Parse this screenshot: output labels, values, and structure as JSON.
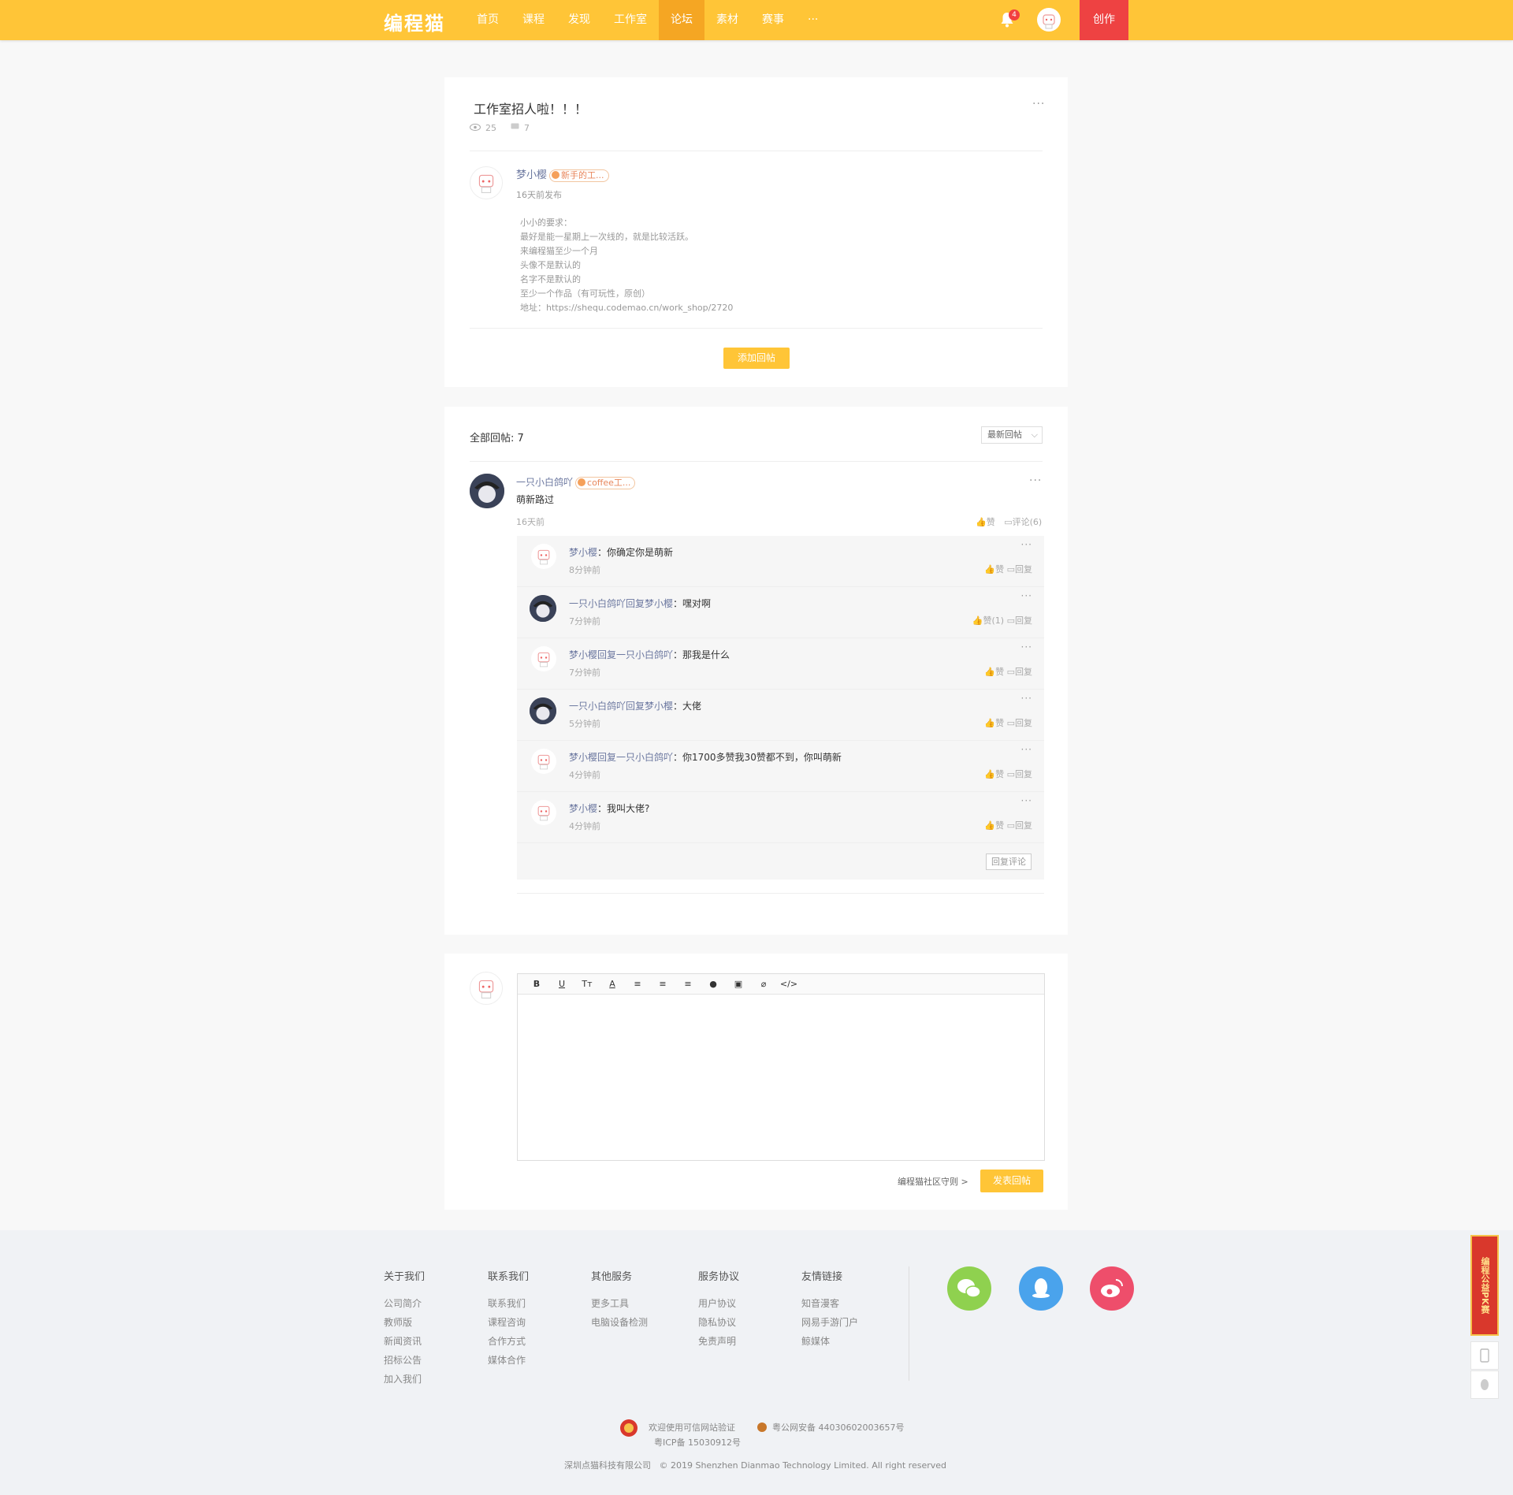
{
  "header": {
    "logo": "编程猫",
    "nav": [
      "首页",
      "课程",
      "发现",
      "工作室",
      "论坛",
      "素材",
      "赛事",
      "···"
    ],
    "active_nav": 4,
    "notif_count": "4",
    "create_label": "创作"
  },
  "post": {
    "title": "工作室招人啦！！！",
    "views": "25",
    "replies": "7",
    "author": "梦小樱",
    "author_badge": "新手的工...",
    "time": "16天前发布",
    "body": [
      "小小的要求：",
      "最好是能一星期上一次线的，就是比较活跃。",
      "来编程猫至少一个月",
      "头像不是默认的",
      "名字不是默认的",
      "至少一个作品（有可玩性，原创）",
      "地址：https://shequ.codemao.cn/work_shop/2720"
    ],
    "add_reply": "添加回帖",
    "more": "···"
  },
  "replies": {
    "title": "全部回帖: 7",
    "sort": "最新回帖",
    "main": {
      "author": "一只小白鸽吖",
      "badge": "coffee工...",
      "text": "萌新路过",
      "time": "16天前",
      "like": "赞",
      "comment": "评论(6)"
    },
    "subs": [
      {
        "text_name": "梦小樱",
        "text": "：你确定你是萌新",
        "time": "8分钟前",
        "like": "赞",
        "reply": "回复",
        "avatar": "light"
      },
      {
        "text_name": "一只小白鸽吖回复梦小樱",
        "text": "：嘿对啊",
        "time": "7分钟前",
        "like": "赞(1)",
        "reply": "回复",
        "avatar": "dark"
      },
      {
        "text_name": "梦小樱回复一只小白鸽吖",
        "text": "：那我是什么",
        "time": "7分钟前",
        "like": "赞",
        "reply": "回复",
        "avatar": "light"
      },
      {
        "text_name": "一只小白鸽吖回复梦小樱",
        "text": "：大佬",
        "time": "5分钟前",
        "like": "赞",
        "reply": "回复",
        "avatar": "dark"
      },
      {
        "text_name": "梦小樱回复一只小白鸽吖",
        "text": "：你1700多赞我30赞都不到，你叫萌新",
        "time": "4分钟前",
        "like": "赞",
        "reply": "回复",
        "avatar": "light"
      },
      {
        "text_name": "梦小樱",
        "text": "：我叫大佬?",
        "time": "4分钟前",
        "like": "赞",
        "reply": "回复",
        "avatar": "light"
      }
    ],
    "reply_comment": "回复评论"
  },
  "editor": {
    "tools": [
      "B",
      "U",
      "Tт",
      "A",
      "≡",
      "≡",
      "≡",
      "●",
      "▣",
      "⌀",
      "</>"
    ],
    "rules": "编程猫社区守则 >",
    "submit": "发表回帖"
  },
  "footer": {
    "cols": [
      {
        "title": "关于我们",
        "links": [
          "公司简介",
          "教师版",
          "新闻资讯",
          "招标公告",
          "加入我们"
        ]
      },
      {
        "title": "联系我们",
        "links": [
          "联系我们",
          "课程咨询",
          "合作方式",
          "媒体合作"
        ]
      },
      {
        "title": "其他服务",
        "links": [
          "更多工具",
          "电脑设备检测"
        ]
      },
      {
        "title": "服务协议",
        "links": [
          "用户协议",
          "隐私协议",
          "免责声明"
        ]
      },
      {
        "title": "友情链接",
        "links": [
          "知音漫客",
          "网易手游门户",
          "鲸媒体"
        ]
      }
    ],
    "trust": "欢迎使用可信网站验证",
    "police": "粤公网安备 44030602003657号",
    "icp": "粤ICP备 15030912号",
    "copyright": "深圳点猫科技有限公司   © 2019 Shenzhen Dianmao Technology Limited. All right reserved",
    "colors": {
      "wechat": "#8fd14f",
      "qq": "#4aa3ec",
      "weibo": "#ee4e6b"
    }
  },
  "side": {
    "ad": "编程公益PK赛"
  }
}
